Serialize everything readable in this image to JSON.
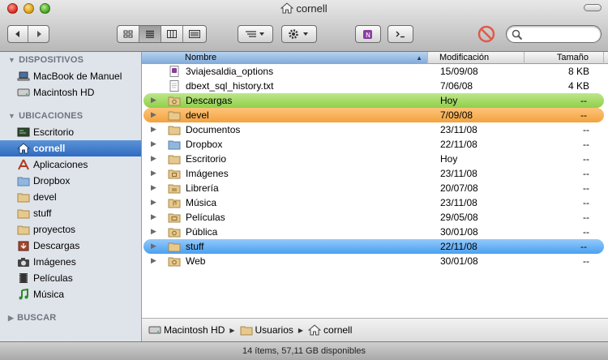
{
  "window": {
    "title": "cornell"
  },
  "sidebar": {
    "sections": [
      {
        "label": "DISPOSITIVOS"
      },
      {
        "label": "UBICACIONES"
      },
      {
        "label": "BUSCAR"
      }
    ],
    "devices": [
      {
        "label": "MacBook de Manuel",
        "icon": "laptop-icon"
      },
      {
        "label": "Macintosh HD",
        "icon": "hard-drive-icon"
      }
    ],
    "places": [
      {
        "label": "Escritorio",
        "icon": "desktop-icon"
      },
      {
        "label": "cornell",
        "icon": "home-icon"
      },
      {
        "label": "Aplicaciones",
        "icon": "applications-icon"
      },
      {
        "label": "Dropbox",
        "icon": "dropbox-folder-icon"
      },
      {
        "label": "devel",
        "icon": "folder-icon"
      },
      {
        "label": "stuff",
        "icon": "folder-icon"
      },
      {
        "label": "proyectos",
        "icon": "folder-icon"
      },
      {
        "label": "Descargas",
        "icon": "downloads-icon"
      },
      {
        "label": "Imágenes",
        "icon": "camera-icon"
      },
      {
        "label": "Películas",
        "icon": "film-icon"
      },
      {
        "label": "Música",
        "icon": "music-note-icon"
      }
    ]
  },
  "columns": {
    "name": "Nombre",
    "modified": "Modificación",
    "size": "Tamaño"
  },
  "files": [
    {
      "name": "3viajesaldia_options",
      "modified": "15/09/08",
      "size": "8 KB",
      "label": ""
    },
    {
      "name": "dbext_sql_history.txt",
      "modified": "7/06/08",
      "size": "4 KB",
      "label": ""
    },
    {
      "name": "Descargas",
      "modified": "Hoy",
      "size": "--",
      "label": "green"
    },
    {
      "name": "devel",
      "modified": "7/09/08",
      "size": "--",
      "label": "orange"
    },
    {
      "name": "Documentos",
      "modified": "23/11/08",
      "size": "--",
      "label": ""
    },
    {
      "name": "Dropbox",
      "modified": "22/11/08",
      "size": "--",
      "label": ""
    },
    {
      "name": "Escritorio",
      "modified": "Hoy",
      "size": "--",
      "label": ""
    },
    {
      "name": "Imágenes",
      "modified": "23/11/08",
      "size": "--",
      "label": ""
    },
    {
      "name": "Librería",
      "modified": "20/07/08",
      "size": "--",
      "label": ""
    },
    {
      "name": "Música",
      "modified": "23/11/08",
      "size": "--",
      "label": ""
    },
    {
      "name": "Películas",
      "modified": "29/05/08",
      "size": "--",
      "label": ""
    },
    {
      "name": "Pública",
      "modified": "30/01/08",
      "size": "--",
      "label": ""
    },
    {
      "name": "stuff",
      "modified": "22/11/08",
      "size": "--",
      "label": "blue"
    },
    {
      "name": "Web",
      "modified": "30/01/08",
      "size": "--",
      "label": ""
    }
  ],
  "path": [
    "Macintosh HD",
    "Usuarios",
    "cornell"
  ],
  "status": "14 ítems, 57,11 GB disponibles",
  "colors": {
    "sidebar_bg": "#dfe4ea",
    "selection": "#3a74c8",
    "label_green": "#9bd55a",
    "label_orange": "#f6ad4e",
    "label_blue": "#5eaaf2"
  }
}
